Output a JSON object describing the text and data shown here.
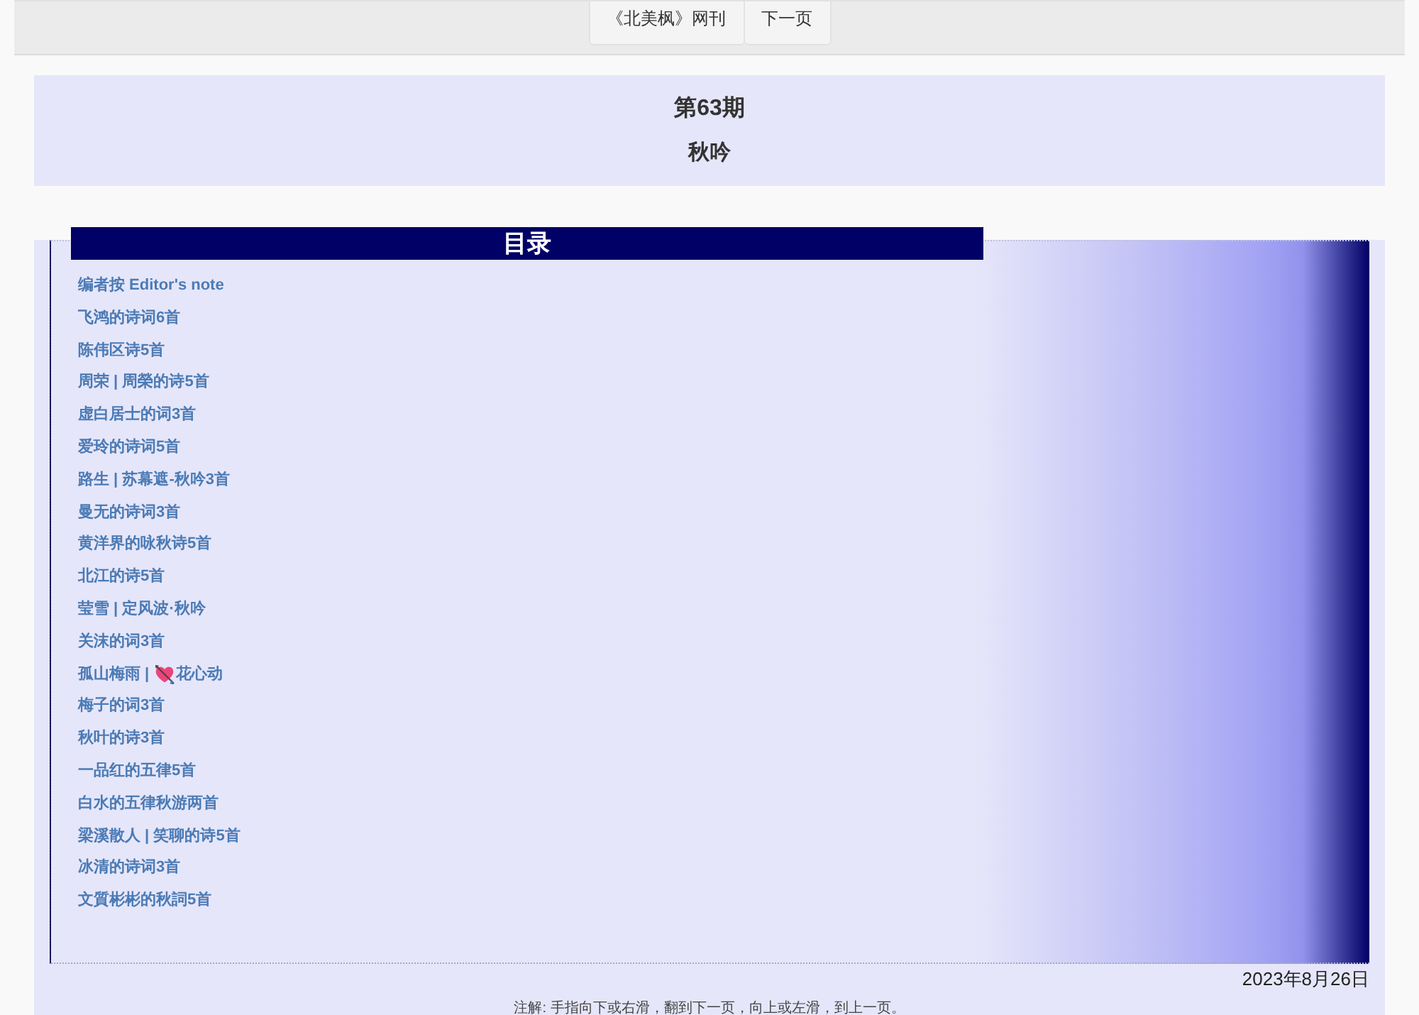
{
  "nav": {
    "items": [
      {
        "label": "《北美枫》网刊"
      },
      {
        "label": "下一页"
      }
    ]
  },
  "header": {
    "issue": "第63期",
    "title": "秋吟"
  },
  "contents": {
    "title": "目录",
    "items": [
      {
        "kind": "text",
        "label": "编者按 Editor's note"
      },
      {
        "kind": "text",
        "label": "飞鸿的诗词6首"
      },
      {
        "kind": "text",
        "label": "陈伟区诗5首"
      },
      {
        "kind": "text",
        "label": "周荣 | 周榮的诗5首"
      },
      {
        "kind": "text",
        "label": "虚白居士的词3首"
      },
      {
        "kind": "text",
        "label": "爱玲的诗词5首"
      },
      {
        "kind": "text",
        "label": "路生 | 苏幕遮-秋吟3首"
      },
      {
        "kind": "text",
        "label": "曼无的诗词3首"
      },
      {
        "kind": "text",
        "label": "黄洋界的咏秋诗5首"
      },
      {
        "kind": "text",
        "label": "北江的诗5首"
      },
      {
        "kind": "text",
        "label": "莹雪 | 定风波·秋吟"
      },
      {
        "kind": "text",
        "label": "关沫的词3首"
      },
      {
        "kind": "emoji",
        "label": "孤山梅雨 |",
        "label_after": "花心动"
      },
      {
        "kind": "text",
        "label": "梅子的词3首"
      },
      {
        "kind": "text",
        "label": "秋叶的诗3首"
      },
      {
        "kind": "text",
        "label": "一品红的五律5首"
      },
      {
        "kind": "text",
        "label": "白水的五律秋游两首"
      },
      {
        "kind": "text",
        "label": "梁溪散人 | 笑聊的诗5首"
      },
      {
        "kind": "text",
        "label": "冰清的诗词3首"
      },
      {
        "kind": "text",
        "label": "文質彬彬的秋詞5首"
      }
    ]
  },
  "date": "2023年8月26日",
  "note": "注解: 手指向下或右滑，翻到下一页，向上或左滑，到上一页。"
}
